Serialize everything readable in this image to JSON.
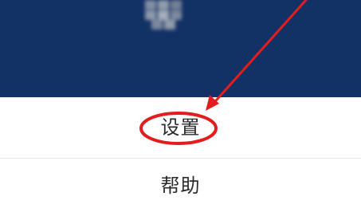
{
  "menu": {
    "items": [
      {
        "label": "设置"
      },
      {
        "label": "帮助"
      }
    ]
  },
  "colors": {
    "header_background": "#123165",
    "annotation": "#e31d1d",
    "divider": "#e6e6e6"
  },
  "icons": {
    "blurred_avatar": "blurred-avatar-icon"
  }
}
